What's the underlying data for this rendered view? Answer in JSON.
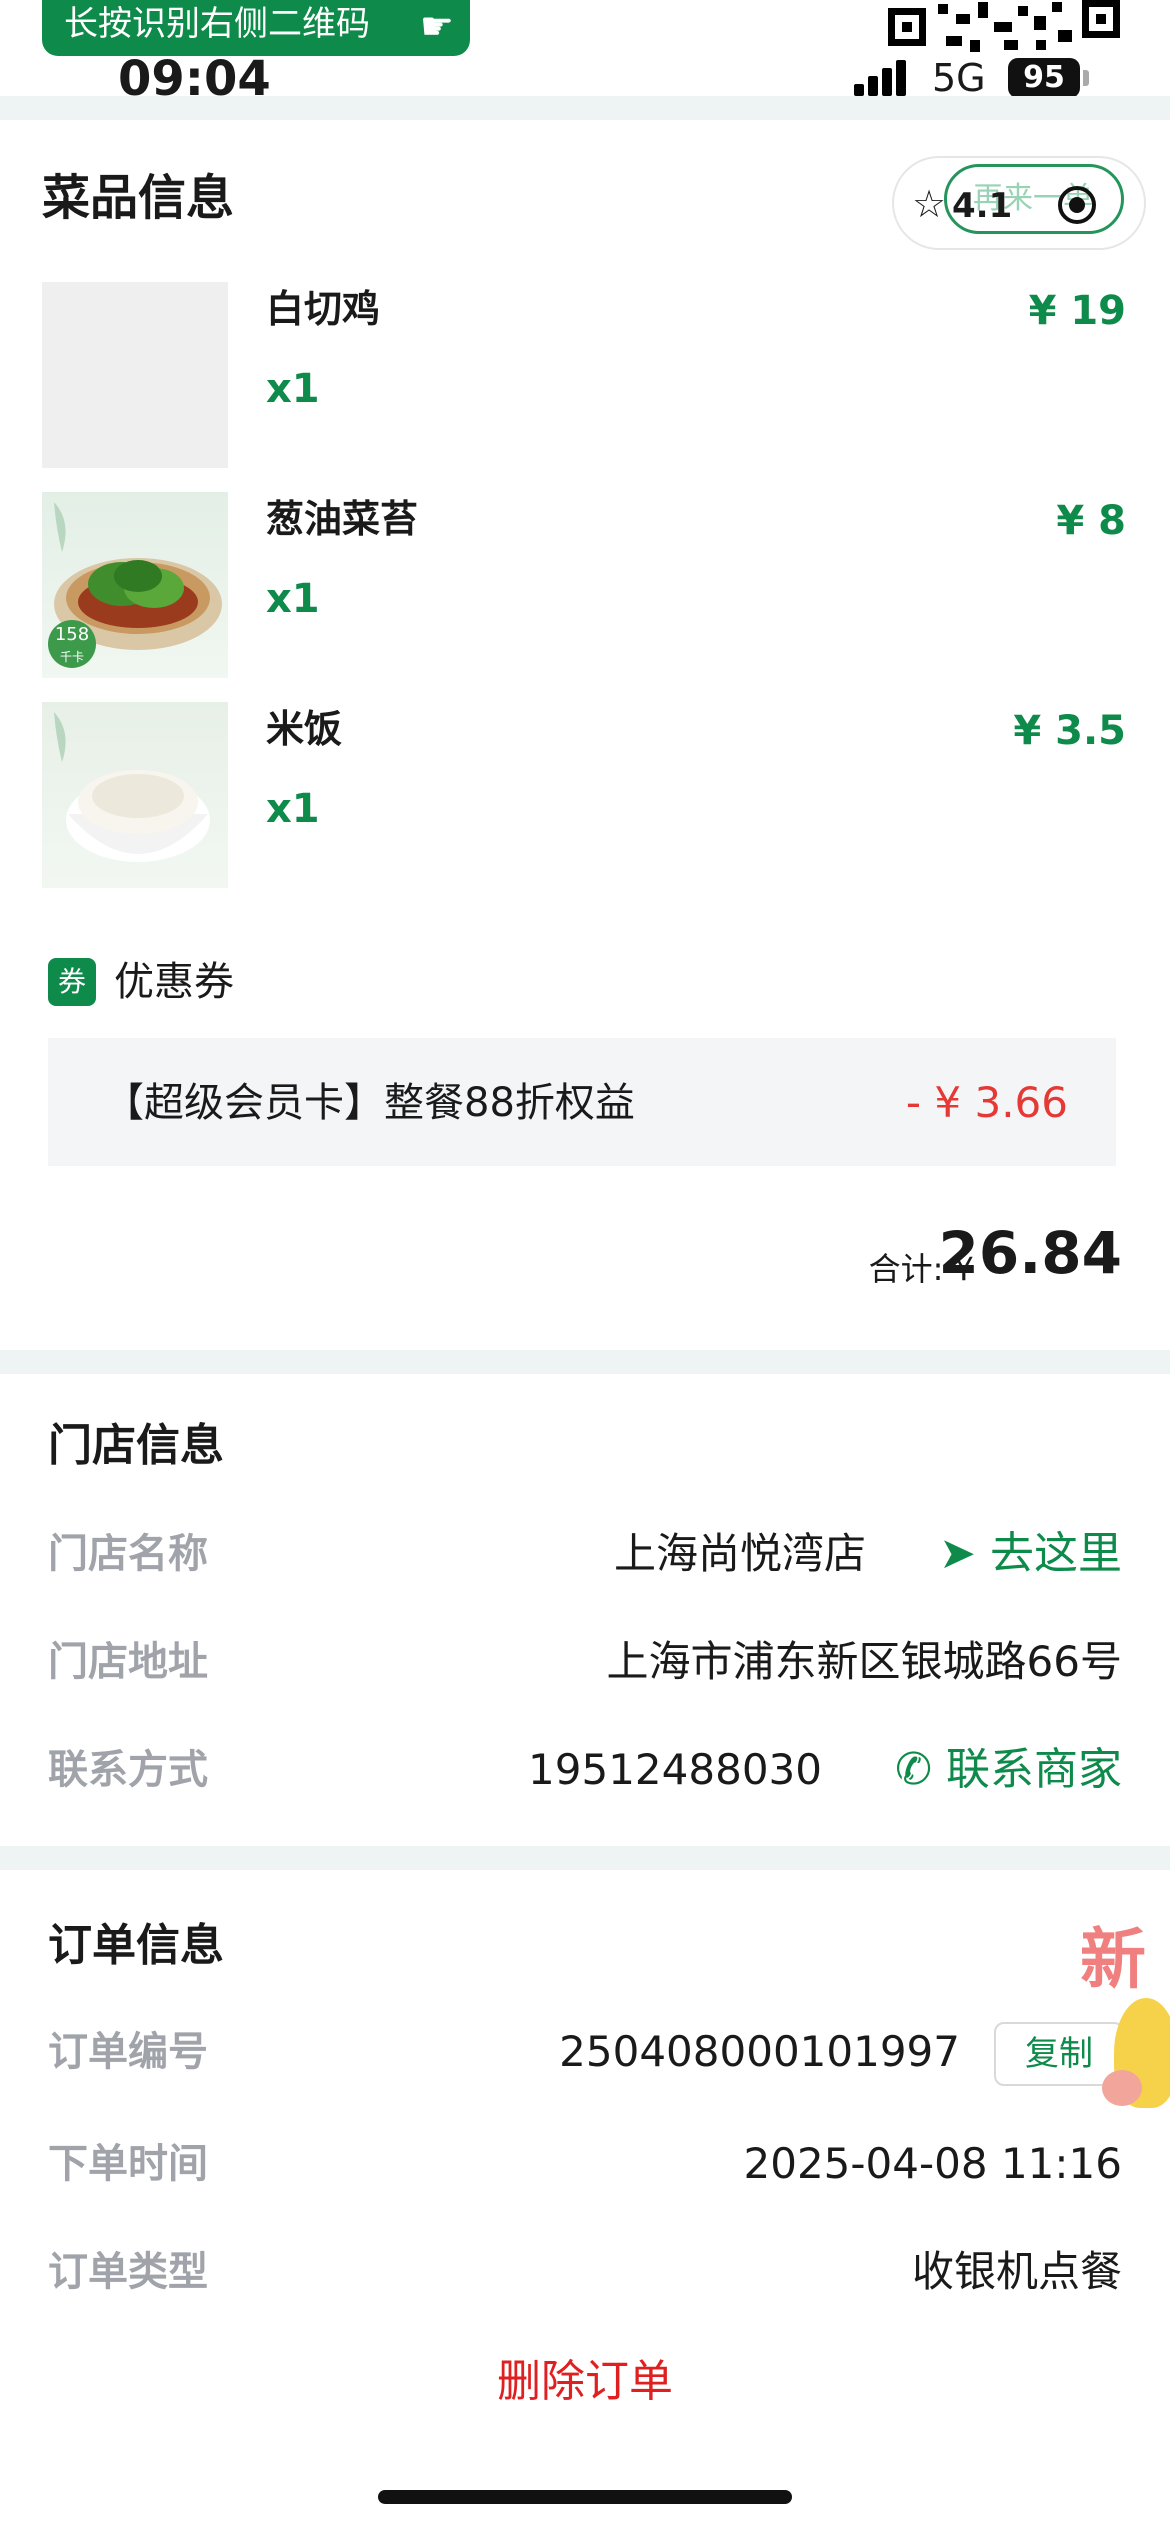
{
  "status_bar": {
    "qr_hint": "长按识别右侧二维码",
    "time": "09:04",
    "network": "5G",
    "battery": "95"
  },
  "dishes_section": {
    "title": "菜品信息",
    "capsule": {
      "rating": "4.1",
      "again_label": "再来一单"
    },
    "items": [
      {
        "name": "白切鸡",
        "qty": "x1",
        "price": "¥ 19"
      },
      {
        "name": "葱油菜苔",
        "qty": "x1",
        "price": "¥ 8"
      },
      {
        "name": "米饭",
        "qty": "x1",
        "price": "¥ 3.5"
      }
    ],
    "greens_badge": "158",
    "greens_badge_sub": "千卡",
    "coupon_badge": "券",
    "coupon_label": "优惠券",
    "coupon_text": "【超级会员卡】整餐88折权益",
    "coupon_discount": "- ¥ 3.66",
    "total_label": "合计: ¥",
    "total_value": "26.84"
  },
  "store_section": {
    "title": "门店信息",
    "name_label": "门店名称",
    "name_value": "上海尚悦湾店",
    "navigate_label": "去这里",
    "address_label": "门店地址",
    "address_value": "上海市浦东新区银城路66号",
    "contact_label": "联系方式",
    "contact_value": "19512488030",
    "contact_link": "联系商家"
  },
  "order_section": {
    "title": "订单信息",
    "number_label": "订单编号",
    "number_value": "250408000101997",
    "copy_label": "复制",
    "time_label": "下单时间",
    "time_value": "2025-04-08 11:16",
    "type_label": "订单类型",
    "type_value": "收银机点餐",
    "sticker_text": "新"
  },
  "delete_label": "删除订单",
  "colors": {
    "brand_green": "#0e8a4a",
    "discount_red": "#e53935",
    "delete_red": "#e02020"
  }
}
